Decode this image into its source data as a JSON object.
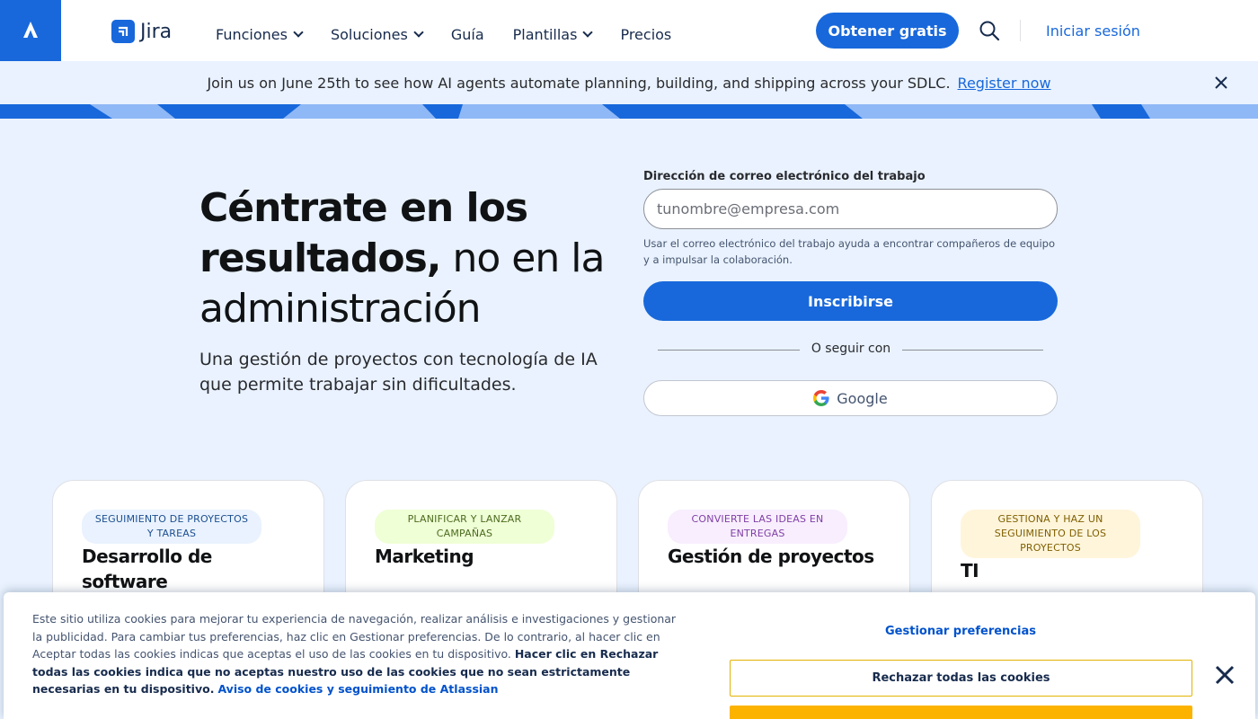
{
  "nav": {
    "brand": "Jira",
    "items": [
      {
        "label": "Funciones",
        "has_dropdown": true
      },
      {
        "label": "Soluciones",
        "has_dropdown": true
      },
      {
        "label": "Guía",
        "has_dropdown": false
      },
      {
        "label": "Plantillas",
        "has_dropdown": true
      },
      {
        "label": "Precios",
        "has_dropdown": false
      }
    ],
    "cta": "Obtener gratis",
    "login": "Iniciar sesión",
    "icons": {
      "logo": "atlassian-logo-icon",
      "search": "search-icon"
    }
  },
  "banner": {
    "text": "Join us on June 25th to see how AI agents automate planning, building, and shipping across your SDLC.",
    "link": "Register now"
  },
  "hero": {
    "title_bold_1": "Céntrate en los",
    "title_bold_2": "resultados,",
    "title_light_1": " no en la",
    "title_light_2": "administración",
    "subtitle": "Una gestión de proyectos con tecnología de IA que permite trabajar sin dificultades."
  },
  "signup": {
    "label": "Dirección de correo electrónico del trabajo",
    "placeholder": "tunombre@empresa.com",
    "hint": "Usar el correo electrónico del trabajo ayuda a encontrar compañeros de equipo y a impulsar la colaboración.",
    "submit": "Inscribirse",
    "divider": "O seguir con",
    "google": "Google"
  },
  "cards": [
    {
      "tag": "SEGUIMIENTO DE PROYECTOS Y TAREAS",
      "title": "Desarrollo de software",
      "tag_bg": "#e9f2fe",
      "tag_color": "#1d4f91"
    },
    {
      "tag": "PLANIFICAR Y LANZAR CAMPAÑAS",
      "title": "Marketing",
      "tag_bg": "#efffd6",
      "tag_color": "#4c6b1f"
    },
    {
      "tag": "CONVIERTE LAS IDEAS EN ENTREGAS",
      "title": "Gestión de proyectos",
      "tag_bg": "#f8eefe",
      "tag_color": "#803fa5"
    },
    {
      "tag": "GESTIONA Y HAZ UN SEGUIMIENTO DE LOS PROYECTOS",
      "title": "TI",
      "tag_bg": "#fff5db",
      "tag_color": "#7f5f01"
    }
  ],
  "cookie": {
    "text_plain": "Este sitio utiliza cookies para mejorar tu experiencia de navegación, realizar análisis e investigaciones y gestionar la publicidad. Para cambiar tus preferencias, haz clic en Gestionar preferencias. De lo contrario, al hacer clic en Aceptar todas las cookies indicas que aceptas el uso de las cookies en tu dispositivo. ",
    "text_bold": "Hacer clic en Rechazar todas las cookies indica que no aceptas nuestro uso de las cookies que no sean estrictamente necesarias en tu dispositivo.",
    "link": "Aviso de cookies y seguimiento de Atlassian",
    "manage": "Gestionar preferencias",
    "reject": "Rechazar todas las cookies"
  },
  "colors": {
    "brand": "#1868db",
    "hero_bg": "#e9f2fe",
    "accept": "#fcb300"
  }
}
